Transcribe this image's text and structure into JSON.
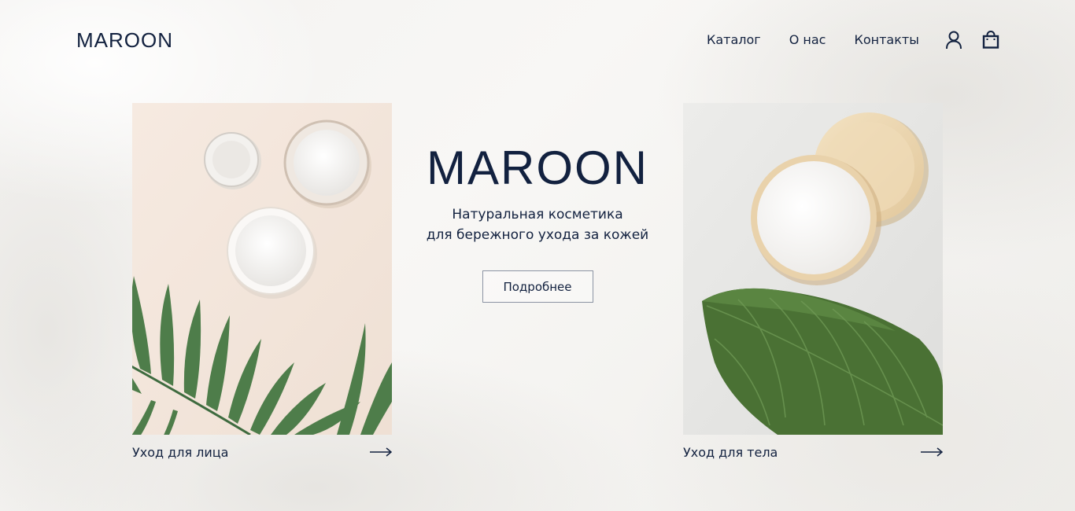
{
  "header": {
    "logo": "MAROON",
    "nav": [
      {
        "label": "Каталог"
      },
      {
        "label": "О нас"
      },
      {
        "label": "Контакты"
      }
    ],
    "icons": [
      "user-icon",
      "shopping-bag-icon"
    ]
  },
  "hero": {
    "brand": "MAROON",
    "tagline_line1": "Натуральная косметика",
    "tagline_line2": "для бережного ухода за кожей",
    "button_label": "Подробнее"
  },
  "cards": [
    {
      "label": "Уход для лица",
      "image": "face-care-jars-with-fern-photo",
      "icon": "arrow-right-icon"
    },
    {
      "label": "Уход для тела",
      "image": "body-care-jar-with-leaf-photo",
      "icon": "arrow-right-icon"
    }
  ],
  "colors": {
    "text": "#12213f",
    "background": "#f4f3f1",
    "button_border": "#8b93a3"
  }
}
